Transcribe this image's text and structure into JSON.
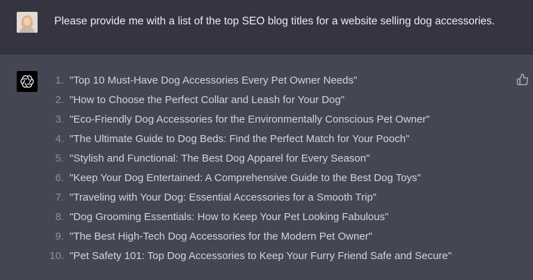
{
  "user_message": {
    "text": "Please provide me with a list of the top SEO blog titles for a website selling dog accessories.",
    "avatar_icon": "user-avatar"
  },
  "assistant_message": {
    "logo_icon": "openai-logo-icon",
    "feedback_icon": "thumbs-up-icon",
    "items": [
      {
        "num": "1.",
        "text": "\"Top 10 Must-Have Dog Accessories Every Pet Owner Needs\""
      },
      {
        "num": "2.",
        "text": "\"How to Choose the Perfect Collar and Leash for Your Dog\""
      },
      {
        "num": "3.",
        "text": "\"Eco-Friendly Dog Accessories for the Environmentally Conscious Pet Owner\""
      },
      {
        "num": "4.",
        "text": "\"The Ultimate Guide to Dog Beds: Find the Perfect Match for Your Pooch\""
      },
      {
        "num": "5.",
        "text": "\"Stylish and Functional: The Best Dog Apparel for Every Season\""
      },
      {
        "num": "6.",
        "text": "\"Keep Your Dog Entertained: A Comprehensive Guide to the Best Dog Toys\""
      },
      {
        "num": "7.",
        "text": "\"Traveling with Your Dog: Essential Accessories for a Smooth Trip\""
      },
      {
        "num": "8.",
        "text": "\"Dog Grooming Essentials: How to Keep Your Pet Looking Fabulous\""
      },
      {
        "num": "9.",
        "text": "\"The Best High-Tech Dog Accessories for the Modern Pet Owner\""
      },
      {
        "num": "10.",
        "text": "\"Pet Safety 101: Top Dog Accessories to Keep Your Furry Friend Safe and Secure\""
      }
    ]
  },
  "colors": {
    "user_bg": "#343541",
    "assistant_bg": "#444654",
    "text": "#d1d5db",
    "number": "#8e8ea0"
  }
}
